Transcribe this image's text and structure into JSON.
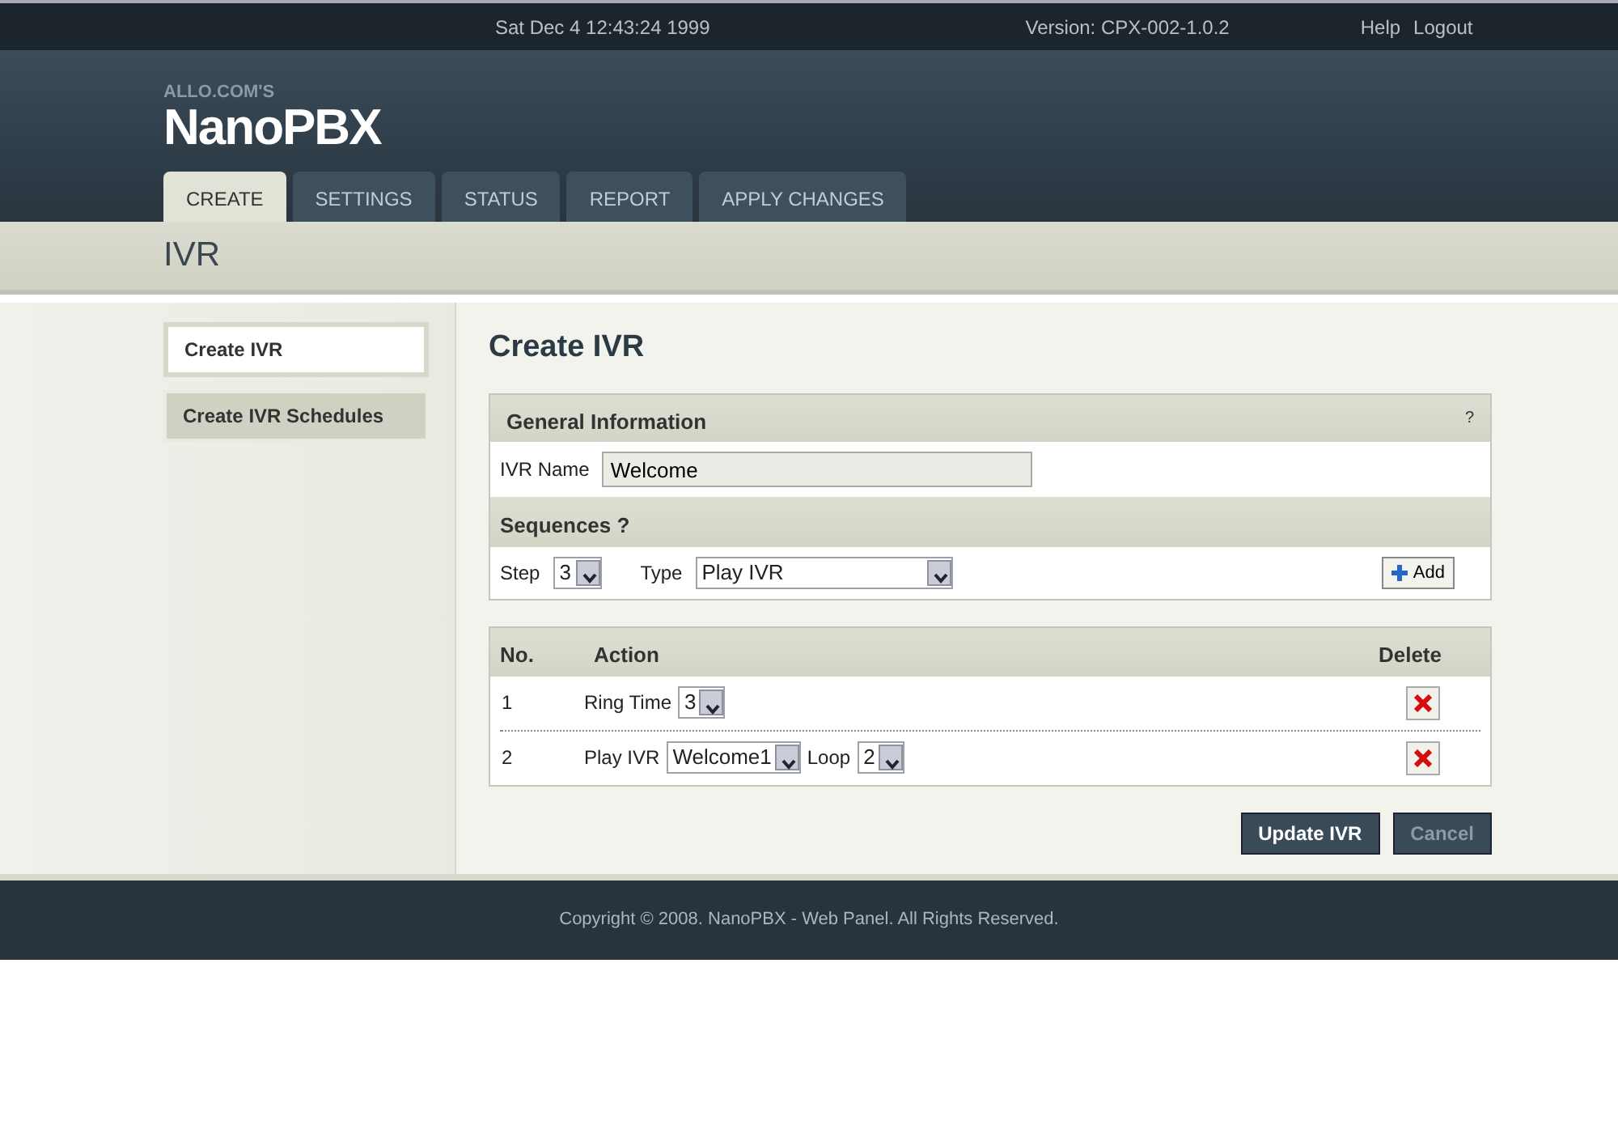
{
  "top_bar": {
    "datetime": "Sat Dec 4 12:43:24 1999",
    "version": "Version: CPX-002-1.0.2",
    "links": [
      "Help",
      "Logout"
    ]
  },
  "logo": {
    "tagline": "ALLO.COM'S",
    "name": "NanoPBX"
  },
  "tabs": [
    {
      "label": "CREATE",
      "selected": true
    },
    {
      "label": "SETTINGS",
      "selected": false
    },
    {
      "label": "STATUS",
      "selected": false
    },
    {
      "label": "REPORT",
      "selected": false
    },
    {
      "label": "APPLY CHANGES",
      "selected": false
    }
  ],
  "page_title": "IVR",
  "sidebar": {
    "items": [
      {
        "label": "Create IVR",
        "selected": true
      },
      {
        "label": "Create IVR Schedules",
        "selected": false
      }
    ]
  },
  "main": {
    "heading": "Create IVR",
    "general": {
      "title": "General Information",
      "help": "?",
      "name_label": "IVR Name",
      "name_value": "Welcome"
    },
    "sequences": {
      "title": "Sequences ?",
      "step_label": "Step",
      "step_value": "3",
      "type_label": "Type",
      "type_value": "Play IVR",
      "add_button": "Add"
    },
    "table": {
      "columns": [
        "No.",
        "Action",
        "Delete"
      ],
      "rows": [
        {
          "no": "1",
          "fields": [
            {
              "label": "Ring Time",
              "value": "3"
            }
          ]
        },
        {
          "no": "2",
          "fields": [
            {
              "label": "Play IVR",
              "value": "Welcome1"
            },
            {
              "label": "Loop",
              "value": "2"
            }
          ]
        }
      ]
    },
    "buttons": [
      {
        "label": "Update IVR",
        "disabled": false
      },
      {
        "label": "Cancel",
        "disabled": true
      }
    ]
  },
  "footer": "Copyright © 2008. NanoPBX - Web Panel. All Rights Reserved."
}
